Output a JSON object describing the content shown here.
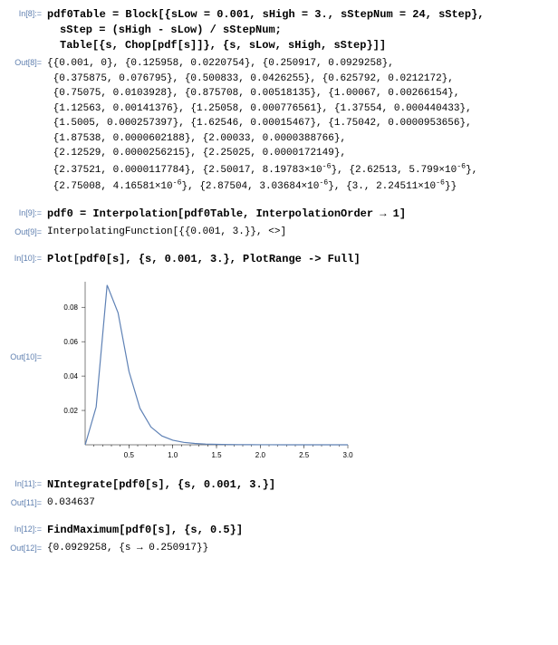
{
  "cells": {
    "in8_label": "In[8]:=",
    "in8_line1": "pdf0Table = Block[{sLow = 0.001, sHigh = 3., sStepNum = 24, sStep},",
    "in8_line2": "sStep = (sHigh - sLow) / sStepNum;",
    "in8_line3": "Table[{s, Chop[pdf[s]]}, {s, sLow, sHigh, sStep}]]",
    "out8_label": "Out[8]=",
    "out8_text": "{{0.001, 0}, {0.125958, 0.0220754}, {0.250917, 0.0929258}, {0.375875, 0.076795}, {0.500833, 0.0426255}, {0.625792, 0.0212172}, {0.75075, 0.0103928}, {0.875708, 0.00518135}, {1.00067, 0.00266154}, {1.12563, 0.00141376}, {1.25058, 0.000776561}, {1.37554, 0.000440433}, {1.5005, 0.000257397}, {1.62546, 0.00015467}, {1.75042, 0.0000953656}, {1.87538, 0.0000602188}, {2.00033, 0.0000388766}, {2.12529, 0.0000256215}, {2.25025, 0.0000172149}, {2.37521, 0.0000117784}, {2.50017, 8.19783×10⁻⁶}, {2.62513, 5.799×10⁻⁶}, {2.75008, 4.16581×10⁻⁶}, {2.87504, 3.03684×10⁻⁶}, {3., 2.24511×10⁻⁶}}",
    "in9_label": "In[9]:=",
    "in9_text": "pdf0 = Interpolation[pdf0Table, InterpolationOrder → 1]",
    "out9_label": "Out[9]=",
    "out9_text": "InterpolatingFunction[{{0.001, 3.}}, <>]",
    "in10_label": "In[10]:=",
    "in10_text": "Plot[pdf0[s], {s, 0.001, 3.}, PlotRange -> Full]",
    "out10_label": "Out[10]=",
    "in11_label": "In[11]:=",
    "in11_text": "NIntegrate[pdf0[s], {s, 0.001, 3.}]",
    "out11_label": "Out[11]=",
    "out11_text": "0.034637",
    "in12_label": "In[12]:=",
    "in12_text": "FindMaximum[pdf0[s], {s, 0.5}]",
    "out12_label": "Out[12]=",
    "out12_text": "{0.0929258, {s → 0.250917}}"
  },
  "chart_data": {
    "type": "line",
    "x": [
      0.001,
      0.125958,
      0.250917,
      0.375875,
      0.500833,
      0.625792,
      0.75075,
      0.875708,
      1.00067,
      1.12563,
      1.25058,
      1.37554,
      1.5005,
      1.62546,
      1.75042,
      1.87538,
      2.00033,
      2.12529,
      2.25025,
      2.37521,
      2.50017,
      2.62513,
      2.75008,
      2.87504,
      3.0
    ],
    "y": [
      0,
      0.0220754,
      0.0929258,
      0.076795,
      0.0426255,
      0.0212172,
      0.0103928,
      0.00518135,
      0.00266154,
      0.00141376,
      0.000776561,
      0.000440433,
      0.000257397,
      0.00015467,
      9.53656e-05,
      6.02188e-05,
      3.88766e-05,
      2.56215e-05,
      1.72149e-05,
      1.17784e-05,
      8.19783e-06,
      5.799e-06,
      4.16581e-06,
      3.03684e-06,
      2.24511e-06
    ],
    "xlim": [
      0,
      3.0
    ],
    "ylim": [
      0,
      0.093
    ],
    "xticks": [
      0.5,
      1.0,
      1.5,
      2.0,
      2.5,
      3.0
    ],
    "yticks": [
      0.02,
      0.04,
      0.06,
      0.08
    ],
    "title": "",
    "xlabel": "",
    "ylabel": ""
  }
}
